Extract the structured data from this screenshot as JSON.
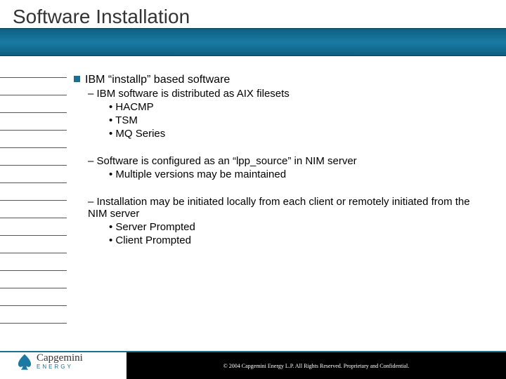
{
  "slide": {
    "title": "Software Installation"
  },
  "content": {
    "main": "IBM “installp” based software",
    "sec1": {
      "head": "IBM software is distributed as AIX filesets",
      "i1": "HACMP",
      "i2": "TSM",
      "i3": "MQ Series"
    },
    "sec2": {
      "head": "Software is configured as an “lpp_source” in NIM server",
      "i1": "Multiple versions may be maintained"
    },
    "sec3": {
      "head": "Installation may be initiated locally from each client or remotely initiated from the NIM server",
      "i1": "Server Prompted",
      "i2": "Client Prompted"
    }
  },
  "footer": {
    "copyright": "© 2004 Capgemini Energy L.P.  All Rights Reserved.  Proprietary and Confidential.",
    "logo_main": "Capgemini",
    "logo_sub": "ENERGY"
  }
}
